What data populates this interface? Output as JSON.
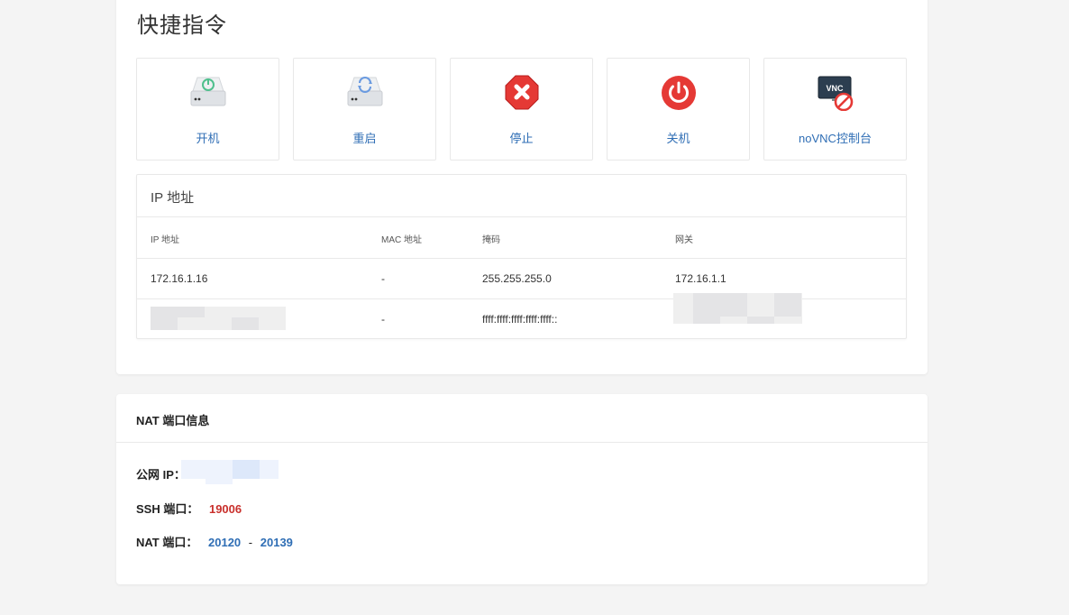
{
  "quick_commands": {
    "title": "快捷指令",
    "actions": [
      {
        "label": "开机",
        "icon": "power-on-drive-icon"
      },
      {
        "label": "重启",
        "icon": "restart-drive-icon"
      },
      {
        "label": "停止",
        "icon": "stop-sign-icon"
      },
      {
        "label": "关机",
        "icon": "power-off-icon"
      },
      {
        "label": "noVNC控制台",
        "icon": "novnc-disabled-icon",
        "icon_text": "VNC"
      }
    ]
  },
  "ip_table": {
    "title": "IP 地址",
    "headers": [
      "IP 地址",
      "MAC 地址",
      "掩码",
      "网关"
    ],
    "rows": [
      [
        "172.16.1.16",
        "-",
        "255.255.255.0",
        "172.16.1.1"
      ],
      [
        "",
        "-",
        "ffff:ffff:ffff:ffff:ffff::",
        ""
      ]
    ]
  },
  "nat": {
    "title": "NAT 端口信息",
    "public_ip_label": "公网 IP：",
    "ssh_label": "SSH 端口：",
    "ssh_port": "19006",
    "nat_label": "NAT 端口：",
    "nat_start": "20120",
    "nat_sep": "-",
    "nat_end": "20139"
  },
  "colors": {
    "link": "#2f6eb5",
    "ssh_port": "#c9302c",
    "stop": "#e53935"
  }
}
